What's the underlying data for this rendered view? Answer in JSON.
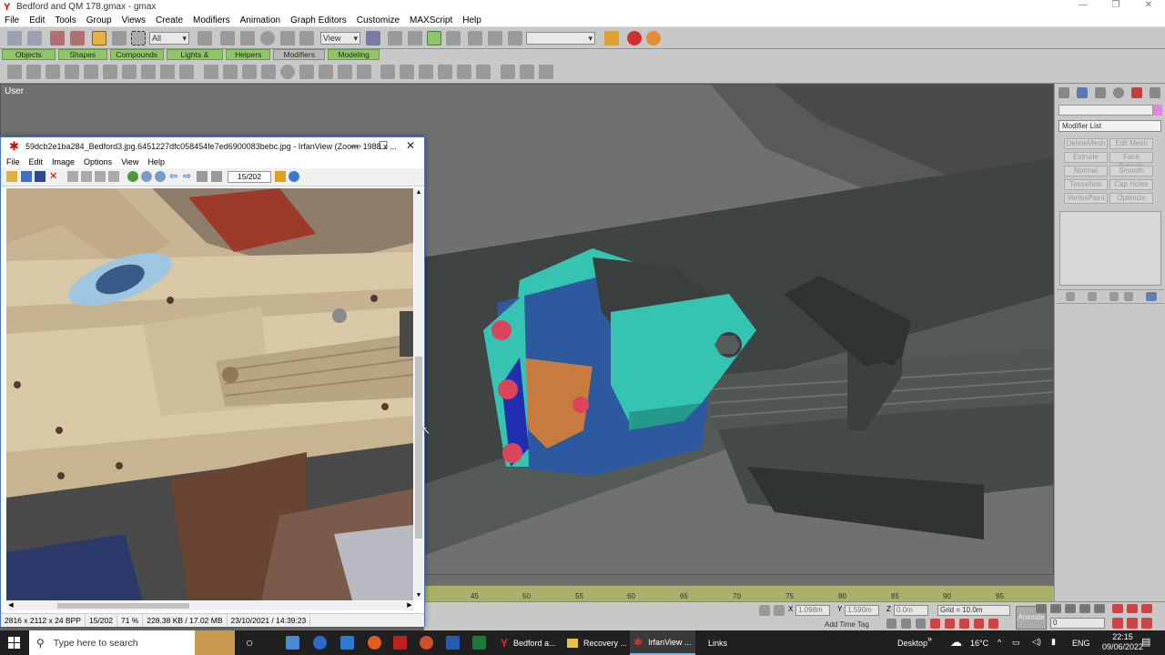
{
  "gmax": {
    "title": "Bedford and QM 178.gmax - gmax",
    "menu": [
      "File",
      "Edit",
      "Tools",
      "Group",
      "Views",
      "Create",
      "Modifiers",
      "Animation",
      "Graph Editors",
      "Customize",
      "MAXScript",
      "Help"
    ],
    "selection_filter": "All",
    "view_dropdown": "View",
    "tabs": [
      "Objects",
      "Shapes",
      "Compounds",
      "Lights & Cameras",
      "Helpers",
      "Modifiers",
      "Modeling"
    ],
    "active_tab": "Modifiers",
    "viewport_label": "User"
  },
  "command_panel": {
    "modifier_list": "Modifier List",
    "buttons": [
      "DeleteMesh",
      "Edit Mesh",
      "Extrude",
      "Face Extrude",
      "Normal",
      "Smooth",
      "Tessellate",
      "Cap Holes",
      "VertexPaint",
      "Optimize"
    ]
  },
  "timeline": {
    "ticks": [
      "45",
      "50",
      "55",
      "60",
      "65",
      "70",
      "75",
      "80",
      "85",
      "90",
      "95"
    ]
  },
  "status": {
    "x_value": "1.098m",
    "y_value": "1.590m",
    "z_value": "0.0m",
    "x_label": "X",
    "y_label": "Y",
    "z_label": "Z",
    "grid": "Grid = 10.0m",
    "add_time_tag": "Add Time Tag",
    "animate": "Animate",
    "frame": "0"
  },
  "irfanview": {
    "title": "59dcb2e1ba284_Bedford3.jpg.6451227dfc058454fe7ed6900083bebc.jpg - IrfanView (Zoom: 1988 x ...",
    "menu": [
      "File",
      "Edit",
      "Image",
      "Options",
      "View",
      "Help"
    ],
    "page": "15/202",
    "status": [
      "2816 x 2112 x 24 BPP",
      "15/202",
      "71 %",
      "228.38 KB / 17.02 MB",
      "23/10/2021 / 14:39:23"
    ]
  },
  "taskbar": {
    "search_placeholder": "Type here to search",
    "apps": [
      {
        "label": "Bedford a..."
      },
      {
        "label": "Recovery ..."
      },
      {
        "label": "IrfanView ..."
      }
    ],
    "desktop": "Desktop",
    "links": "Links",
    "temperature": "16°C",
    "language": "ENG",
    "time": "22:15",
    "date": "09/06/2022"
  },
  "colors": {
    "accent_teal": "#35c3b2",
    "spring_blue": "#2d5a9e",
    "bolt_red": "#d9455a",
    "timeline_green": "#a8b06a",
    "tab_green": "#8fc46a"
  }
}
